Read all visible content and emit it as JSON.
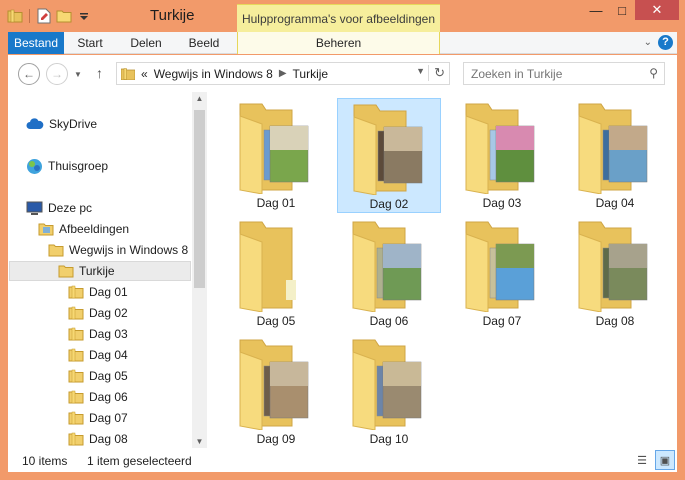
{
  "window": {
    "title": "Turkije"
  },
  "contextual": {
    "group_label": "Hulpprogramma's voor afbeeldingen",
    "tab_label": "Beheren"
  },
  "ribbon": {
    "tabs": [
      "Bestand",
      "Start",
      "Delen",
      "Beeld"
    ]
  },
  "address": {
    "prefix": "«",
    "parts": [
      "Wegwijs in Windows 8",
      "Turkije"
    ]
  },
  "search": {
    "placeholder": "Zoeken in Turkije"
  },
  "nav": {
    "skydrive": "SkyDrive",
    "homegroup": "Thuisgroep",
    "this_pc": "Deze pc",
    "pictures": "Afbeeldingen",
    "wegwijs": "Wegwijs in Windows 8",
    "turkije": "Turkije",
    "days": [
      "Dag 01",
      "Dag 02",
      "Dag 03",
      "Dag 04",
      "Dag 05",
      "Dag 06",
      "Dag 07",
      "Dag 08"
    ]
  },
  "folders": [
    {
      "label": "Dag 01",
      "selected": false
    },
    {
      "label": "Dag 02",
      "selected": true
    },
    {
      "label": "Dag 03",
      "selected": false
    },
    {
      "label": "Dag 04",
      "selected": false
    },
    {
      "label": "Dag 05",
      "selected": false
    },
    {
      "label": "Dag 06",
      "selected": false
    },
    {
      "label": "Dag 07",
      "selected": false
    },
    {
      "label": "Dag 08",
      "selected": false
    },
    {
      "label": "Dag 09",
      "selected": false
    },
    {
      "label": "Dag 10",
      "selected": false
    }
  ],
  "status": {
    "count": "10 items",
    "selected": "1 item geselecteerd"
  },
  "colors": {
    "accent": "#1979ca",
    "frame": "#f29a6a",
    "contextual": "#f6ee9c",
    "selection": "#cce8ff"
  }
}
